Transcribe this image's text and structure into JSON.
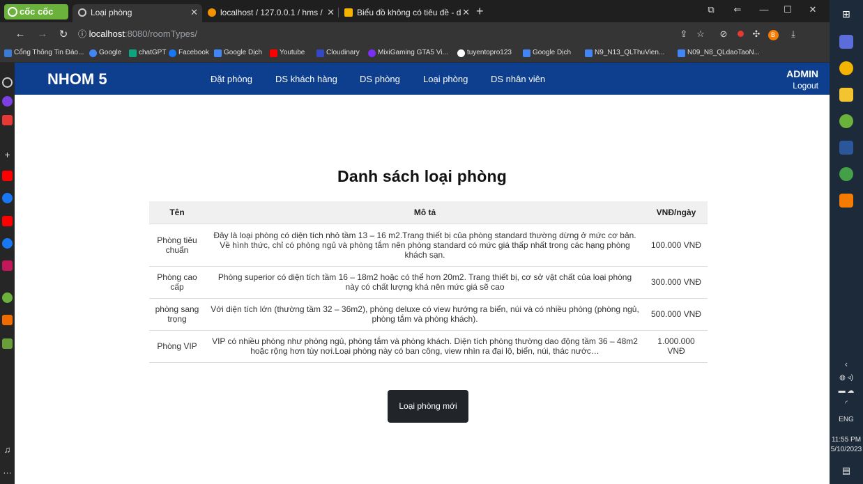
{
  "browser": {
    "logo": "cốc cốc",
    "tabs": [
      {
        "title": "Loại phòng",
        "fav": "#888"
      },
      {
        "title": "localhost / 127.0.0.1 / hms /",
        "fav": "#f39200"
      },
      {
        "title": "Biểu đồ không có tiêu đề - d",
        "fav": "#f4b400"
      }
    ],
    "url_host": "localhost",
    "url_path": ":8080/roomTypes/",
    "bookmarks": [
      {
        "label": "Cổng Thông Tin Đào...",
        "color": "#3a7bd5"
      },
      {
        "label": "Google",
        "color": "#4285f4"
      },
      {
        "label": "chatGPT",
        "color": "#10a37f"
      },
      {
        "label": "Facebook",
        "color": "#1877f2"
      },
      {
        "label": "Google Dịch",
        "color": "#4285f4"
      },
      {
        "label": "Youtube",
        "color": "#ff0000"
      },
      {
        "label": "Cloudinary",
        "color": "#3448c5"
      },
      {
        "label": "MixiGaming GTA5 Vi...",
        "color": "#7b2ff7"
      },
      {
        "label": "tuyentopro123",
        "color": "#ffffff"
      },
      {
        "label": "Google Dịch",
        "color": "#4285f4"
      },
      {
        "label": "N9_N13_QLThuVien...",
        "color": "#4285f4"
      },
      {
        "label": "N09_N8_QLdaoTaoN...",
        "color": "#4285f4"
      }
    ]
  },
  "nav": {
    "brand": "NHOM 5",
    "links": [
      "Đặt phòng",
      "DS khách hàng",
      "DS phòng",
      "Loại phòng",
      "DS nhân viên"
    ],
    "admin": "ADMIN",
    "logout": "Logout"
  },
  "main": {
    "title": "Danh sách loại phòng",
    "headers": [
      "Tên",
      "Mô tả",
      "VNĐ/ngày"
    ],
    "rows": [
      {
        "name": "Phòng tiêu chuẩn",
        "desc": "Đây là loại phòng có diện tích nhỏ tầm 13 – 16 m2.Trang thiết bị của phòng standard thường dừng ở mức cơ bản. Về hình thức, chỉ có phòng ngủ và phòng tắm nên phòng standard có mức giá thấp nhất trong các hạng phòng khách sạn.",
        "price": "100.000 VNĐ"
      },
      {
        "name": "Phòng cao cấp",
        "desc": "Phòng superior có diện tích tầm 16 – 18m2 hoặc có thể hơn 20m2. Trang thiết bị, cơ sở vật chất của loại phòng này có chất lượng khá nên mức giá sẽ cao",
        "price": "300.000 VNĐ"
      },
      {
        "name": "phòng sang trọng",
        "desc": "Với diện tích lớn (thường tầm 32 – 36m2), phòng deluxe có view hướng ra biển, núi và có nhiều phòng (phòng ngủ, phòng tắm và phòng khách).",
        "price": "500.000 VNĐ"
      },
      {
        "name": "Phòng VIP",
        "desc": "VIP có nhiều phòng như phòng ngủ, phòng tắm và phòng khách. Diện tích phòng thường dao động tầm 36 – 48m2 hoặc rộng hơn tùy nơi.Loại phòng này có ban công, view nhìn ra đại lộ, biển, núi, thác nước…",
        "price": "1.000.000 VNĐ"
      }
    ],
    "new_button": "Loại phòng mới"
  },
  "taskbar": {
    "lang": "ENG",
    "time": "11:55 PM",
    "date": "5/10/2023"
  }
}
